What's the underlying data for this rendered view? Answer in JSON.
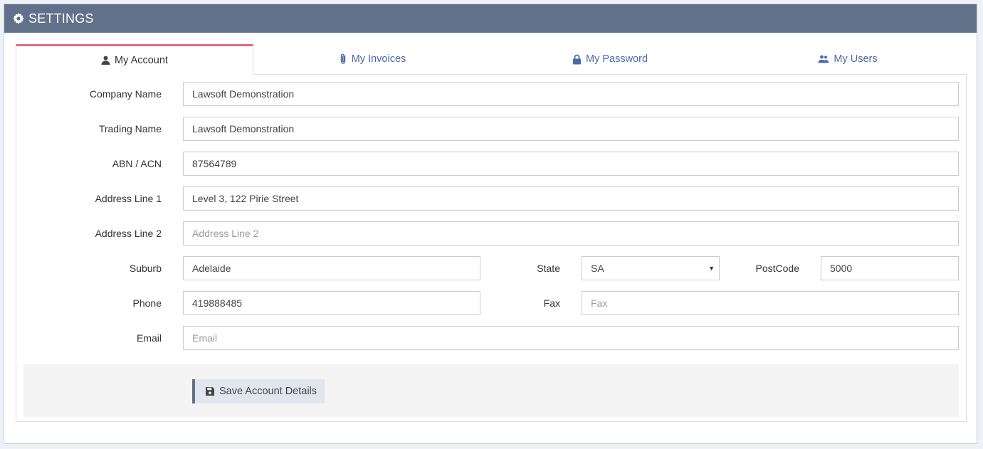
{
  "header": {
    "title": "SETTINGS",
    "icon": "gear-icon"
  },
  "tabs": [
    {
      "label": "My Account",
      "icon": "user-icon",
      "active": true
    },
    {
      "label": "My Invoices",
      "icon": "paperclip-icon",
      "active": false
    },
    {
      "label": "My Password",
      "icon": "lock-icon",
      "active": false
    },
    {
      "label": "My Users",
      "icon": "users-icon",
      "active": false
    }
  ],
  "form": {
    "company_name": {
      "label": "Company Name",
      "value": "Lawsoft Demonstration"
    },
    "trading_name": {
      "label": "Trading Name",
      "value": "Lawsoft Demonstration"
    },
    "abn_acn": {
      "label": "ABN / ACN",
      "value": "87564789"
    },
    "address_line_1": {
      "label": "Address Line 1",
      "value": "Level 3, 122 Pirie Street"
    },
    "address_line_2": {
      "label": "Address Line 2",
      "value": "",
      "placeholder": "Address Line 2"
    },
    "suburb": {
      "label": "Suburb",
      "value": "Adelaide"
    },
    "state": {
      "label": "State",
      "value": "SA"
    },
    "postcode": {
      "label": "PostCode",
      "value": "5000"
    },
    "phone": {
      "label": "Phone",
      "value": "419888485"
    },
    "fax": {
      "label": "Fax",
      "value": "",
      "placeholder": "Fax"
    },
    "email": {
      "label": "Email",
      "value": "",
      "placeholder": "Email"
    }
  },
  "actions": {
    "save_label": "Save Account Details",
    "save_icon": "floppy-disk-icon"
  },
  "colors": {
    "header_bg": "#61718a",
    "active_tab_accent": "#e46c7a",
    "link": "#4a6aa6"
  }
}
